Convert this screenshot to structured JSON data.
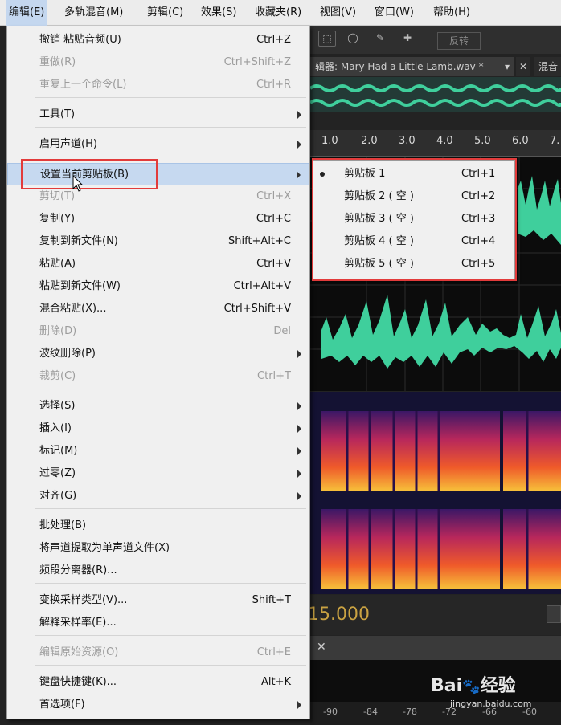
{
  "menubar": [
    "编辑(E)",
    "多轨混音(M)",
    "剪辑(C)",
    "效果(S)",
    "收藏夹(R)",
    "视图(V)",
    "窗口(W)",
    "帮助(H)"
  ],
  "toolbar": {
    "invert_label": "反转"
  },
  "editor_tab": {
    "label": "辑器: Mary Had a Little Lamb.wav *",
    "mixer_tab": "混音"
  },
  "ruler": {
    "labels": [
      "1.0",
      "2.0",
      "3.0",
      "4.0",
      "5.0",
      "6.0",
      "7."
    ]
  },
  "time_display": "15.000",
  "bottom_ruler": {
    "labels": [
      "-90",
      "-84",
      "-78",
      "-72",
      "-66",
      "-60"
    ]
  },
  "edit_menu": {
    "items": [
      {
        "label": "撤销 粘贴音频(U)",
        "shortcut": "Ctrl+Z",
        "disabled": false
      },
      {
        "label": "重做(R)",
        "shortcut": "Ctrl+Shift+Z",
        "disabled": true
      },
      {
        "label": "重复上一个命令(L)",
        "shortcut": "Ctrl+R",
        "disabled": true
      },
      {
        "label": "工具(T)",
        "shortcut": "",
        "disabled": false,
        "submenu": true
      },
      {
        "label": "启用声道(H)",
        "shortcut": "",
        "disabled": false,
        "submenu": true
      },
      {
        "label": "设置当前剪贴板(B)",
        "shortcut": "",
        "disabled": false,
        "submenu": true,
        "highlighted": true
      },
      {
        "label": "剪切(T)",
        "shortcut": "Ctrl+X",
        "disabled": true
      },
      {
        "label": "复制(Y)",
        "shortcut": "Ctrl+C",
        "disabled": false
      },
      {
        "label": "复制到新文件(N)",
        "shortcut": "Shift+Alt+C",
        "disabled": false
      },
      {
        "label": "粘贴(A)",
        "shortcut": "Ctrl+V",
        "disabled": false
      },
      {
        "label": "粘贴到新文件(W)",
        "shortcut": "Ctrl+Alt+V",
        "disabled": false
      },
      {
        "label": "混合粘贴(X)...",
        "shortcut": "Ctrl+Shift+V",
        "disabled": false
      },
      {
        "label": "删除(D)",
        "shortcut": "Del",
        "disabled": true
      },
      {
        "label": "波纹删除(P)",
        "shortcut": "",
        "disabled": false,
        "submenu": true
      },
      {
        "label": "裁剪(C)",
        "shortcut": "Ctrl+T",
        "disabled": true
      },
      {
        "label": "选择(S)",
        "shortcut": "",
        "disabled": false,
        "submenu": true
      },
      {
        "label": "插入(I)",
        "shortcut": "",
        "disabled": false,
        "submenu": true
      },
      {
        "label": "标记(M)",
        "shortcut": "",
        "disabled": false,
        "submenu": true
      },
      {
        "label": "过零(Z)",
        "shortcut": "",
        "disabled": false,
        "submenu": true
      },
      {
        "label": "对齐(G)",
        "shortcut": "",
        "disabled": false,
        "submenu": true
      },
      {
        "label": "批处理(B)",
        "shortcut": "",
        "disabled": false
      },
      {
        "label": "将声道提取为单声道文件(X)",
        "shortcut": "",
        "disabled": false
      },
      {
        "label": "频段分离器(R)...",
        "shortcut": "",
        "disabled": false
      },
      {
        "label": "变换采样类型(V)...",
        "shortcut": "Shift+T",
        "disabled": false
      },
      {
        "label": "解释采样率(E)...",
        "shortcut": "",
        "disabled": false
      },
      {
        "label": "编辑原始资源(O)",
        "shortcut": "Ctrl+E",
        "disabled": true
      },
      {
        "label": "键盘快捷键(K)...",
        "shortcut": "Alt+K",
        "disabled": false
      },
      {
        "label": "首选项(F)",
        "shortcut": "",
        "disabled": false,
        "submenu": true
      }
    ]
  },
  "clipboard_submenu": {
    "items": [
      {
        "label": "剪贴板 1",
        "shortcut": "Ctrl+1",
        "checked": true
      },
      {
        "label": "剪贴板 2 ( 空 )",
        "shortcut": "Ctrl+2",
        "checked": false
      },
      {
        "label": "剪贴板 3 ( 空 )",
        "shortcut": "Ctrl+3",
        "checked": false
      },
      {
        "label": "剪贴板 4 ( 空 )",
        "shortcut": "Ctrl+4",
        "checked": false
      },
      {
        "label": "剪贴板 5 ( 空 )",
        "shortcut": "Ctrl+5",
        "checked": false
      }
    ]
  },
  "watermark": {
    "brand": "Bai",
    "brand2": "经验",
    "url": "jingyan.baidu.com"
  },
  "colors": {
    "waveform": "#3fcf9c",
    "highlight_box": "#e23b3b",
    "menu_bg": "#f0f0f0",
    "menu_hl": "#c6d9f0"
  }
}
